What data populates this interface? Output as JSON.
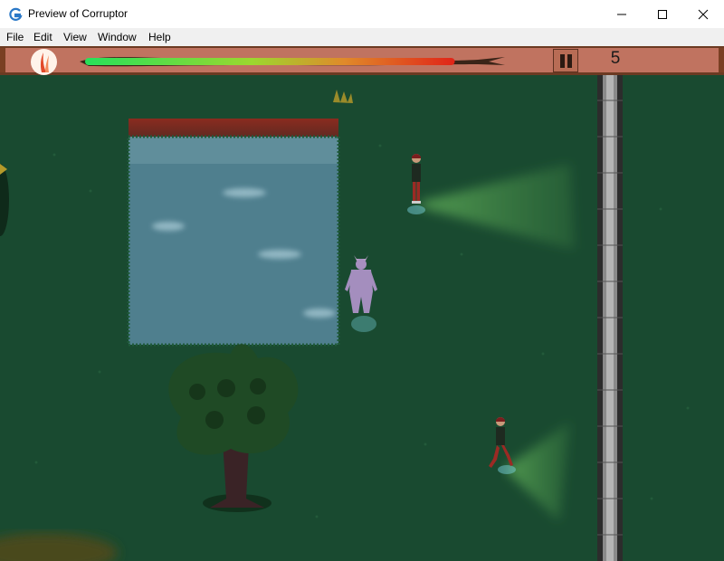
{
  "window": {
    "title": "Preview of Corruptor",
    "icons": {
      "app": "gamemaker-icon",
      "minimize": "minimize-icon",
      "maximize": "maximize-icon",
      "close": "close-icon"
    }
  },
  "menu": {
    "items": [
      "File",
      "Edit",
      "View",
      "Window",
      "Help"
    ]
  },
  "hud": {
    "health_fraction": 0.95,
    "score": "5",
    "pause_icon": "pause-icon",
    "avatar_icon": "claw-avatar-icon",
    "colors": {
      "hud_bg": "#c07360",
      "health_high": "#27e05a",
      "health_low": "#e02418"
    }
  },
  "scene": {
    "ground_color": "#194a30",
    "pond_color": "#4f7f8e",
    "characters": [
      "human-guard",
      "human-guard",
      "horned-demon-player"
    ]
  }
}
